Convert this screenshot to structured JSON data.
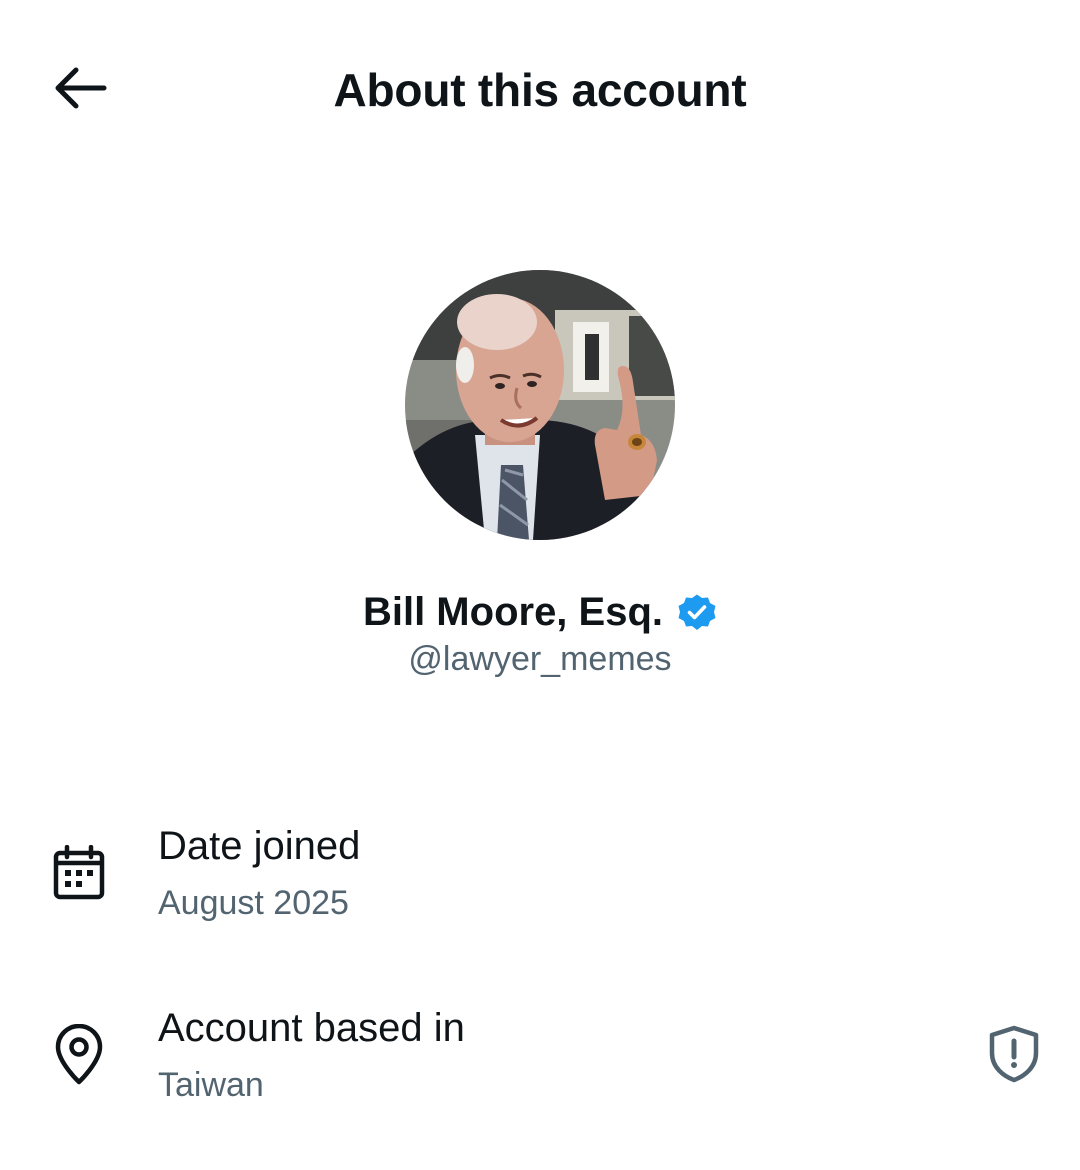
{
  "header": {
    "title": "About this account",
    "back_icon": "arrow-left-icon"
  },
  "profile": {
    "display_name": "Bill Moore, Esq.",
    "handle": "@lawyer_memes",
    "verified_icon": "verified-badge-icon",
    "verified_color": "#1d9bf0"
  },
  "details": [
    {
      "icon": "calendar-icon",
      "label": "Date joined",
      "value": "August 2025"
    },
    {
      "icon": "location-pin-icon",
      "label": "Account based in",
      "value": "Taiwan",
      "action_icon": "shield-alert-icon"
    }
  ],
  "colors": {
    "text_primary": "#0f1419",
    "text_secondary": "#536471",
    "accent": "#1d9bf0",
    "background": "#ffffff"
  }
}
